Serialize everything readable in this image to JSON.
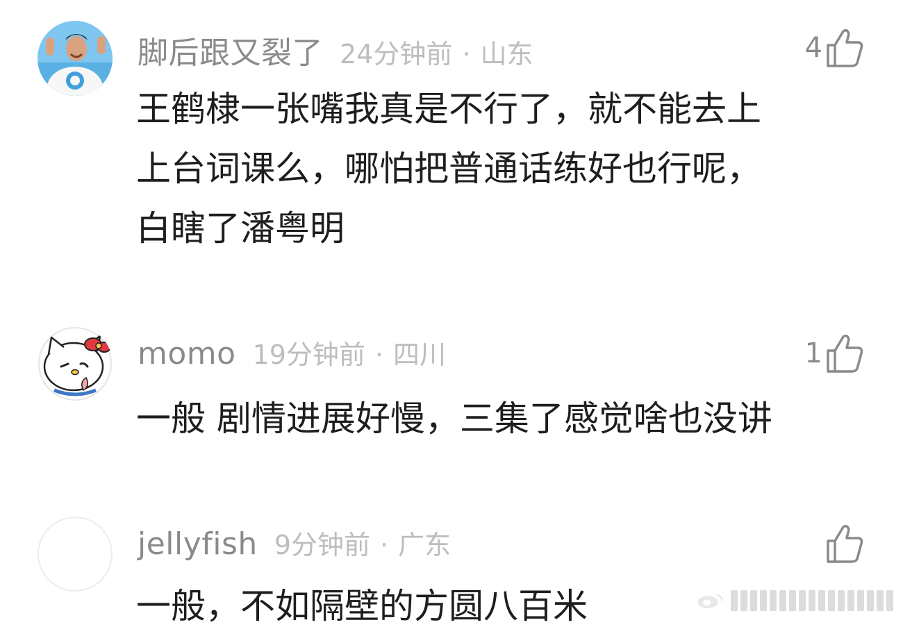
{
  "comments": [
    {
      "username": "脚后跟又裂了",
      "time": "24分钟前",
      "separator": "·",
      "location": "山东",
      "likes": "4",
      "text_lines": [
        "王鹤棣一张嘴我真是不行了，就不能去上",
        "上台词课么，哪怕把普通话练好也行呢，",
        "白瞎了潘粤明"
      ]
    },
    {
      "username": "momo",
      "time": "19分钟前",
      "separator": "·",
      "location": "四川",
      "likes": "1",
      "text_lines": [
        "一般 剧情进展好慢，三集了感觉啥也没讲"
      ]
    },
    {
      "username": "jellyfish",
      "time": "9分钟前",
      "separator": "·",
      "location": "广东",
      "likes": "",
      "text_lines": [
        "一般，不如隔壁的方圆八百米"
      ]
    }
  ],
  "colors": {
    "username": "#8a8a8a",
    "meta": "#bdbdbd",
    "body": "#1e1e1e",
    "icon": "#8a8a8a"
  },
  "icons": {
    "like": "thumbs-up-outline-icon",
    "watermark": "weibo-watermark-logo"
  }
}
